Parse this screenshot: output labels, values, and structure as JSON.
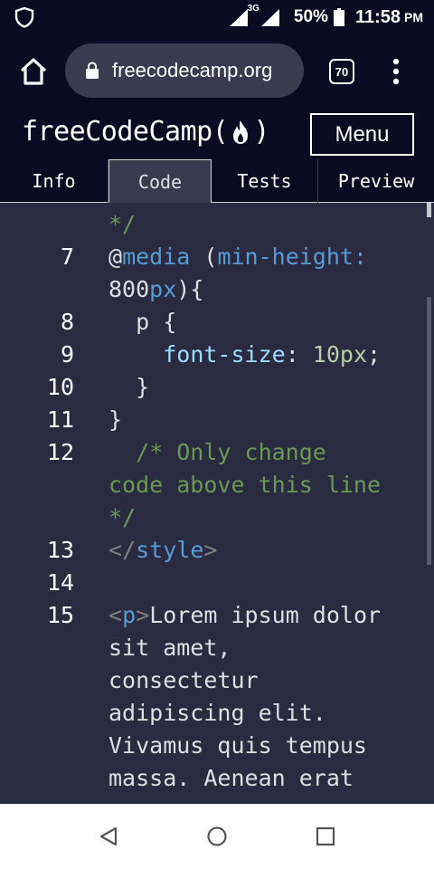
{
  "status_bar": {
    "network": "3G",
    "battery_percent": "50%",
    "time": "11:58",
    "ampm": "PM"
  },
  "browser": {
    "url": "freecodecamp.org",
    "tab_count": "70"
  },
  "fcc": {
    "logo_left": "freeCodeCamp(",
    "logo_right": ")",
    "menu_label": "Menu"
  },
  "editor_tabs": [
    {
      "label": "Info",
      "active": false
    },
    {
      "label": "Code",
      "active": true
    },
    {
      "label": "Tests",
      "active": false
    },
    {
      "label": "Preview",
      "active": false
    }
  ],
  "code_lines": [
    {
      "number": "",
      "segments": [
        {
          "text": "*/",
          "kind": "comment"
        }
      ]
    },
    {
      "number": "7",
      "segments": [
        {
          "text": "@",
          "kind": "text"
        },
        {
          "text": "media",
          "kind": "kw"
        },
        {
          "text": " (",
          "kind": "text"
        },
        {
          "text": "min-height:",
          "kind": "kw"
        }
      ]
    },
    {
      "number": "",
      "segments": [
        {
          "text": "800",
          "kind": "text"
        },
        {
          "text": "px",
          "kind": "kw"
        },
        {
          "text": "){",
          "kind": "text"
        }
      ]
    },
    {
      "number": "8",
      "segments": [
        {
          "text": "  p {",
          "kind": "text"
        }
      ]
    },
    {
      "number": "9",
      "segments": [
        {
          "text": "    ",
          "kind": "text"
        },
        {
          "text": "font-size",
          "kind": "prop"
        },
        {
          "text": ": ",
          "kind": "text"
        },
        {
          "text": "10px",
          "kind": "num"
        },
        {
          "text": ";",
          "kind": "text"
        }
      ]
    },
    {
      "number": "10",
      "segments": [
        {
          "text": "  }",
          "kind": "text"
        }
      ]
    },
    {
      "number": "11",
      "segments": [
        {
          "text": "}",
          "kind": "text"
        }
      ]
    },
    {
      "number": "12",
      "segments": [
        {
          "text": "  /* Only change",
          "kind": "comment"
        }
      ]
    },
    {
      "number": "",
      "segments": [
        {
          "text": "code above this line",
          "kind": "comment"
        }
      ]
    },
    {
      "number": "",
      "segments": [
        {
          "text": "*/",
          "kind": "comment"
        }
      ]
    },
    {
      "number": "13",
      "segments": [
        {
          "text": "</",
          "kind": "tag"
        },
        {
          "text": "style",
          "kind": "kw"
        },
        {
          "text": ">",
          "kind": "tag"
        }
      ]
    },
    {
      "number": "14",
      "segments": []
    },
    {
      "number": "15",
      "segments": [
        {
          "text": "<",
          "kind": "tag"
        },
        {
          "text": "p",
          "kind": "kw"
        },
        {
          "text": ">",
          "kind": "tag"
        },
        {
          "text": "Lorem ipsum dolor",
          "kind": "text"
        }
      ]
    },
    {
      "number": "",
      "segments": [
        {
          "text": "sit amet,",
          "kind": "text"
        }
      ]
    },
    {
      "number": "",
      "segments": [
        {
          "text": "consectetur",
          "kind": "text"
        }
      ]
    },
    {
      "number": "",
      "segments": [
        {
          "text": "adipiscing elit.",
          "kind": "text"
        }
      ]
    },
    {
      "number": "",
      "segments": [
        {
          "text": "Vivamus quis tempus",
          "kind": "text"
        }
      ]
    },
    {
      "number": "",
      "segments": [
        {
          "text": "massa. Aenean erat",
          "kind": "text"
        }
      ]
    }
  ],
  "colors": {
    "background": "#0a0a23",
    "editor_bg": "#2a2a40",
    "comment": "#6a9955",
    "keyword": "#569cd6",
    "number": "#b5cea8"
  }
}
